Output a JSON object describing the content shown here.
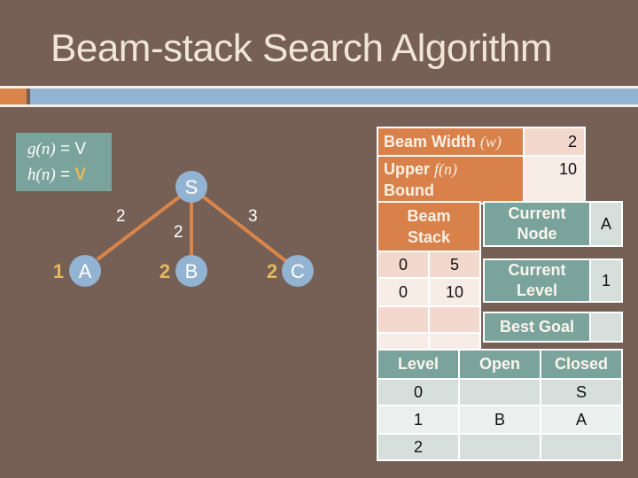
{
  "slide": {
    "title": "Beam-stack Search Algorithm"
  },
  "legend": {
    "g_label": "g(n)",
    "g_value": "V",
    "h_label": "h(n)",
    "h_value": "V",
    "equals": "="
  },
  "graph": {
    "nodes": [
      {
        "id": "S",
        "h": ""
      },
      {
        "id": "A",
        "h": "1"
      },
      {
        "id": "B",
        "h": "2"
      },
      {
        "id": "C",
        "h": "2"
      }
    ],
    "edges": [
      {
        "from": "S",
        "to": "A",
        "cost": "2"
      },
      {
        "from": "S",
        "to": "B",
        "cost": "2"
      },
      {
        "from": "S",
        "to": "C",
        "cost": "3"
      }
    ],
    "colors": {
      "node": "#92b3d1",
      "edge": "#d9854a",
      "h_value": "#e7b95d"
    }
  },
  "params": {
    "beam_width_label": "Beam Width",
    "beam_width_symbol": "(w)",
    "beam_width_value": "2",
    "upper_label_1": "Upper",
    "upper_symbol": "f(n)",
    "upper_label_2": "Bound",
    "upper_value": "10"
  },
  "beam_stack": {
    "header_1": "Beam",
    "header_2": "Stack",
    "rows": [
      [
        "0",
        "5"
      ],
      [
        "0",
        "10"
      ],
      [
        "",
        ""
      ],
      [
        "",
        ""
      ]
    ]
  },
  "status": {
    "current_node_label_1": "Current",
    "current_node_label_2": "Node",
    "current_node_value": "A",
    "current_level_label_1": "Current",
    "current_level_label_2": "Level",
    "current_level_value": "1",
    "best_goal_label": "Best Goal",
    "best_goal_value": ""
  },
  "levels_table": {
    "headers": [
      "Level",
      "Open",
      "Closed"
    ],
    "rows": [
      [
        "0",
        "",
        "S"
      ],
      [
        "1",
        "B",
        "A"
      ],
      [
        "2",
        "",
        ""
      ]
    ]
  }
}
